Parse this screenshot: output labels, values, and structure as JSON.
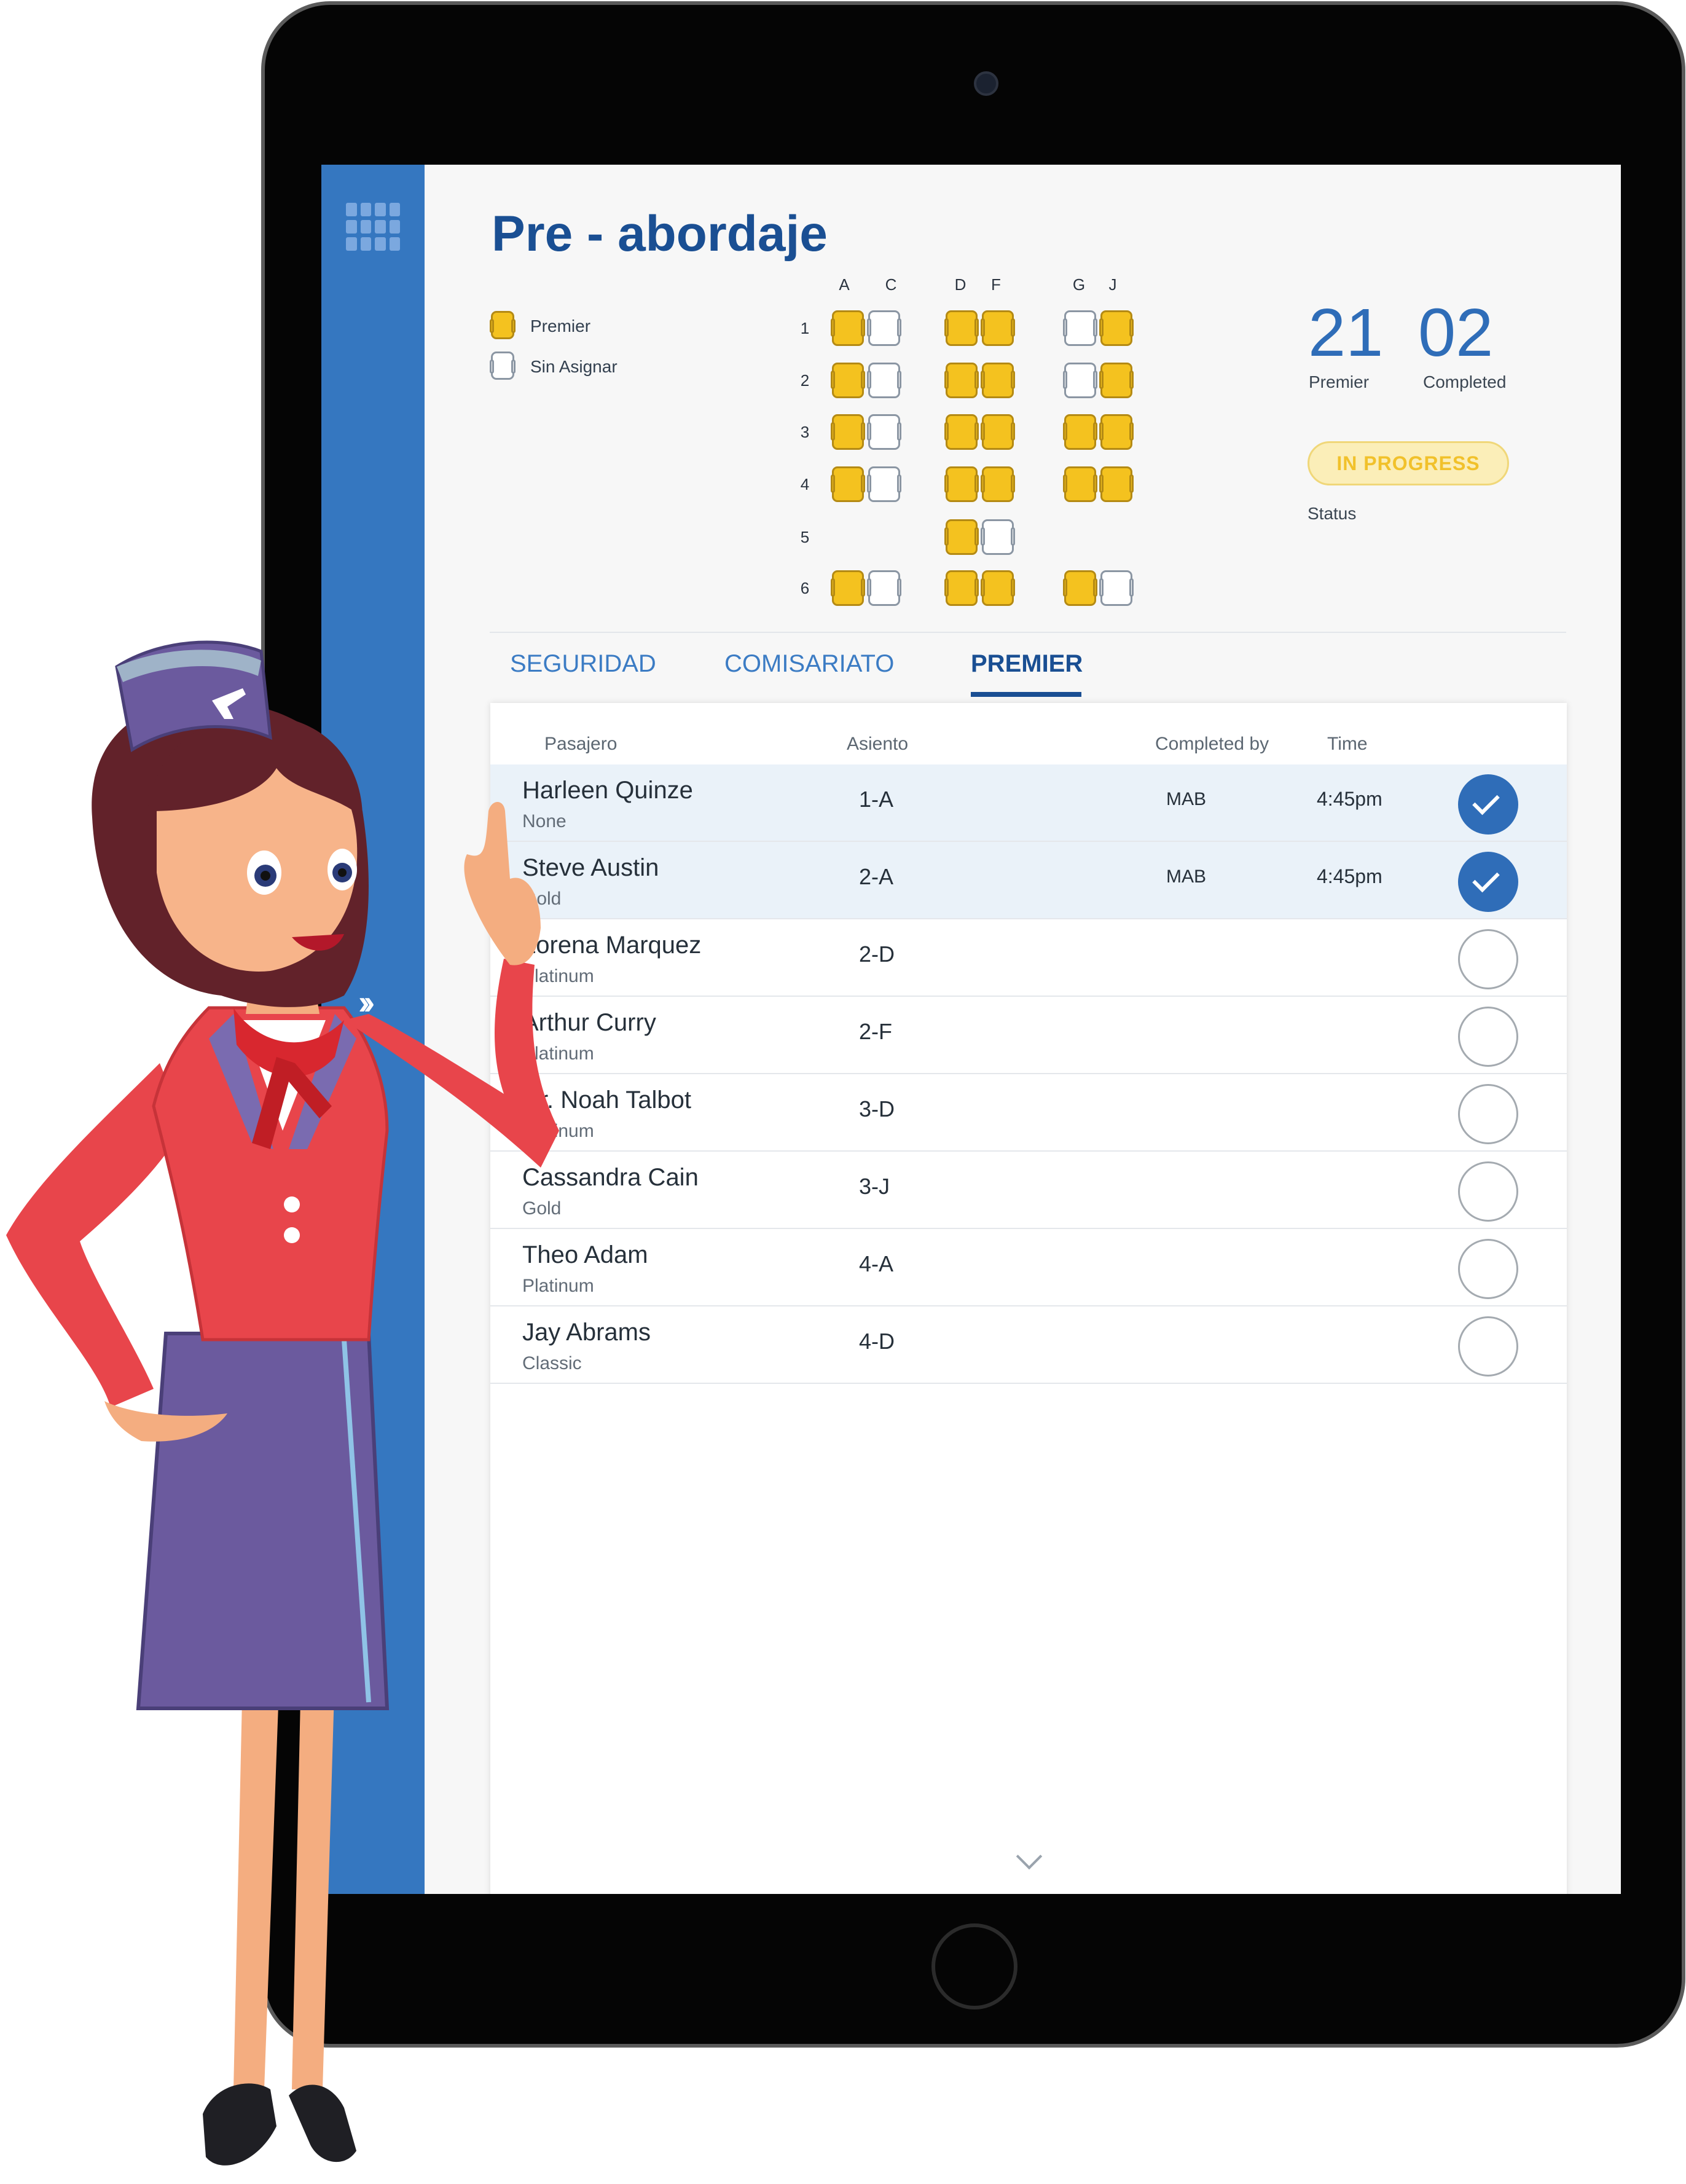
{
  "app": {
    "title": "Pre - abordaje"
  },
  "icons": {
    "menu": "grid-menu-icon",
    "expand": "double-chevron-right-icon",
    "scroll": "chevron-down-icon",
    "check": "checkmark-icon"
  },
  "legend": {
    "items": [
      {
        "label": "Premier",
        "type": "filled"
      },
      {
        "label": "Sin Asignar",
        "type": "empty"
      }
    ]
  },
  "seatmap": {
    "columns": [
      "A",
      "C",
      "D",
      "F",
      "G",
      "J"
    ],
    "rows": [
      {
        "num": "1",
        "seats": {
          "A": "filled",
          "C": "empty",
          "D": "filled",
          "F": "filled",
          "G": "empty",
          "J": "filled"
        }
      },
      {
        "num": "2",
        "seats": {
          "A": "filled",
          "C": "empty",
          "D": "filled",
          "F": "filled",
          "G": "empty",
          "J": "filled"
        }
      },
      {
        "num": "3",
        "seats": {
          "A": "filled",
          "C": "empty",
          "D": "filled",
          "F": "filled",
          "G": "filled",
          "J": "filled"
        }
      },
      {
        "num": "4",
        "seats": {
          "A": "filled",
          "C": "empty",
          "D": "filled",
          "F": "filled",
          "G": "filled",
          "J": "filled"
        }
      },
      {
        "num": "5",
        "seats": {
          "D": "filled",
          "F": "empty"
        }
      },
      {
        "num": "6",
        "seats": {
          "A": "filled",
          "C": "empty",
          "D": "filled",
          "F": "filled",
          "G": "filled",
          "J": "empty"
        }
      }
    ]
  },
  "stats": {
    "premier_value": "21",
    "premier_label": "Premier",
    "completed_value": "02",
    "completed_label": "Completed",
    "status_value": "IN PROGRESS",
    "status_label": "Status"
  },
  "tabs": [
    {
      "label": "SEGURIDAD",
      "active": false
    },
    {
      "label": "COMISARIATO",
      "active": false
    },
    {
      "label": "PREMIER",
      "active": true
    }
  ],
  "table": {
    "headers": {
      "pasajero": "Pasajero",
      "asiento": "Asiento",
      "completed_by": "Completed by",
      "time": "Time"
    },
    "rows": [
      {
        "name": "Harleen Quinze",
        "tier": "None",
        "seat": "1-A",
        "by": "MAB",
        "time": "4:45pm",
        "done": true
      },
      {
        "name": "Steve Austin",
        "tier": "Gold",
        "seat": "2-A",
        "by": "MAB",
        "time": "4:45pm",
        "done": true
      },
      {
        "name": "Lorena Marquez",
        "tier": "Platinum",
        "seat": "2-D",
        "by": "",
        "time": "",
        "done": false
      },
      {
        "name": "Arthur Curry",
        "tier": "Platinum",
        "seat": "2-F",
        "by": "",
        "time": "",
        "done": false
      },
      {
        "name": "Dr. Noah Talbot",
        "tier": "Platinum",
        "seat": "3-D",
        "by": "",
        "time": "",
        "done": false
      },
      {
        "name": "Cassandra Cain",
        "tier": "Gold",
        "seat": "3-J",
        "by": "",
        "time": "",
        "done": false
      },
      {
        "name": "Theo Adam",
        "tier": "Platinum",
        "seat": "4-A",
        "by": "",
        "time": "",
        "done": false
      },
      {
        "name": "Jay Abrams",
        "tier": "Classic",
        "seat": "4-D",
        "by": "",
        "time": "",
        "done": false
      }
    ]
  },
  "colors": {
    "brand_blue": "#3577c0",
    "title_blue": "#1a4f93",
    "premier_yellow": "#f4c21f",
    "status_yellow": "#f1c12b",
    "check_blue": "#2f6db8"
  }
}
